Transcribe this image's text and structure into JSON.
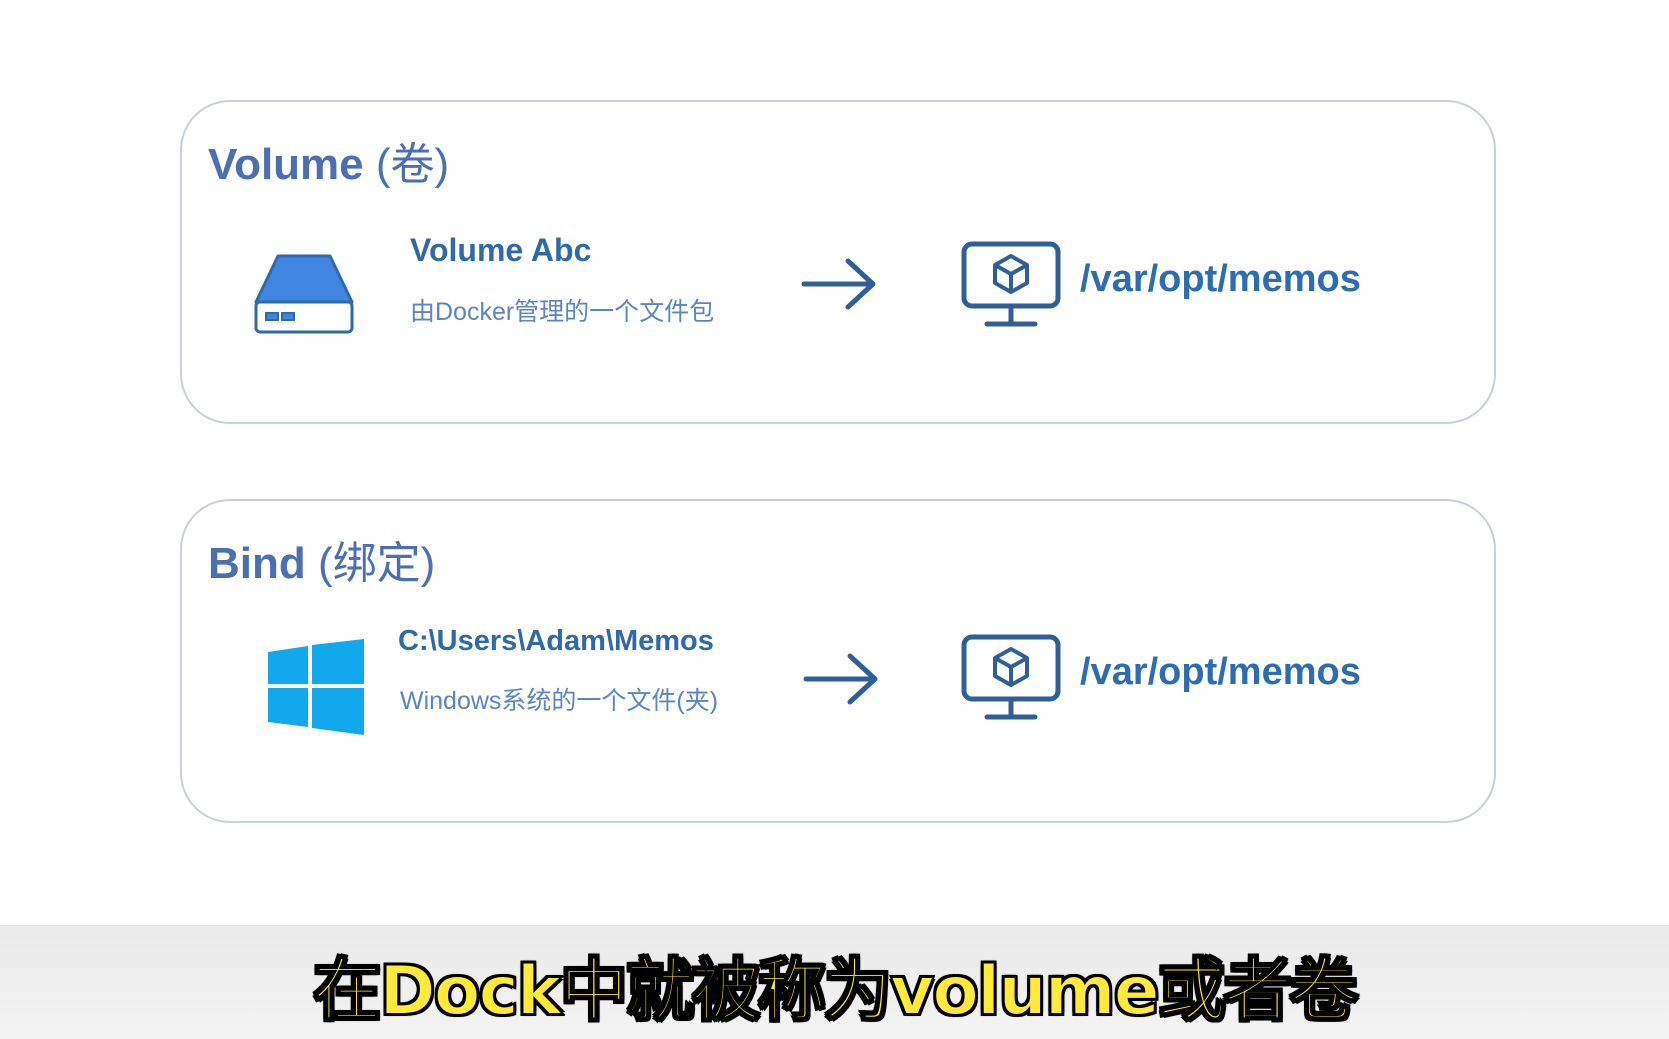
{
  "volume_panel": {
    "title": "Volume",
    "title_sub": "(卷)",
    "source_icon": "drive-icon",
    "source_name": "Volume Abc",
    "source_desc": "由Docker管理的一个文件包",
    "arrow_icon": "arrow-right-icon",
    "target_icon": "container-monitor-icon",
    "target_path": "/var/opt/memos"
  },
  "bind_panel": {
    "title": "Bind",
    "title_sub": "(绑定)",
    "source_icon": "windows-logo-icon",
    "source_name": "C:\\Users\\Adam\\Memos",
    "source_desc": "Windows系统的一个文件(夹)",
    "arrow_icon": "arrow-right-icon",
    "target_icon": "container-monitor-icon",
    "target_path": "/var/opt/memos"
  },
  "subtitle": "在Dock中就被称为volume或者卷",
  "colors": {
    "title": "#4b6fb0",
    "accent": "#2b6db0",
    "drive_blue": "#3f86e0",
    "windows_blue": "#12a9ec",
    "subtitle_yellow": "#ffe93a",
    "panel_border": "#c9cfdb"
  }
}
